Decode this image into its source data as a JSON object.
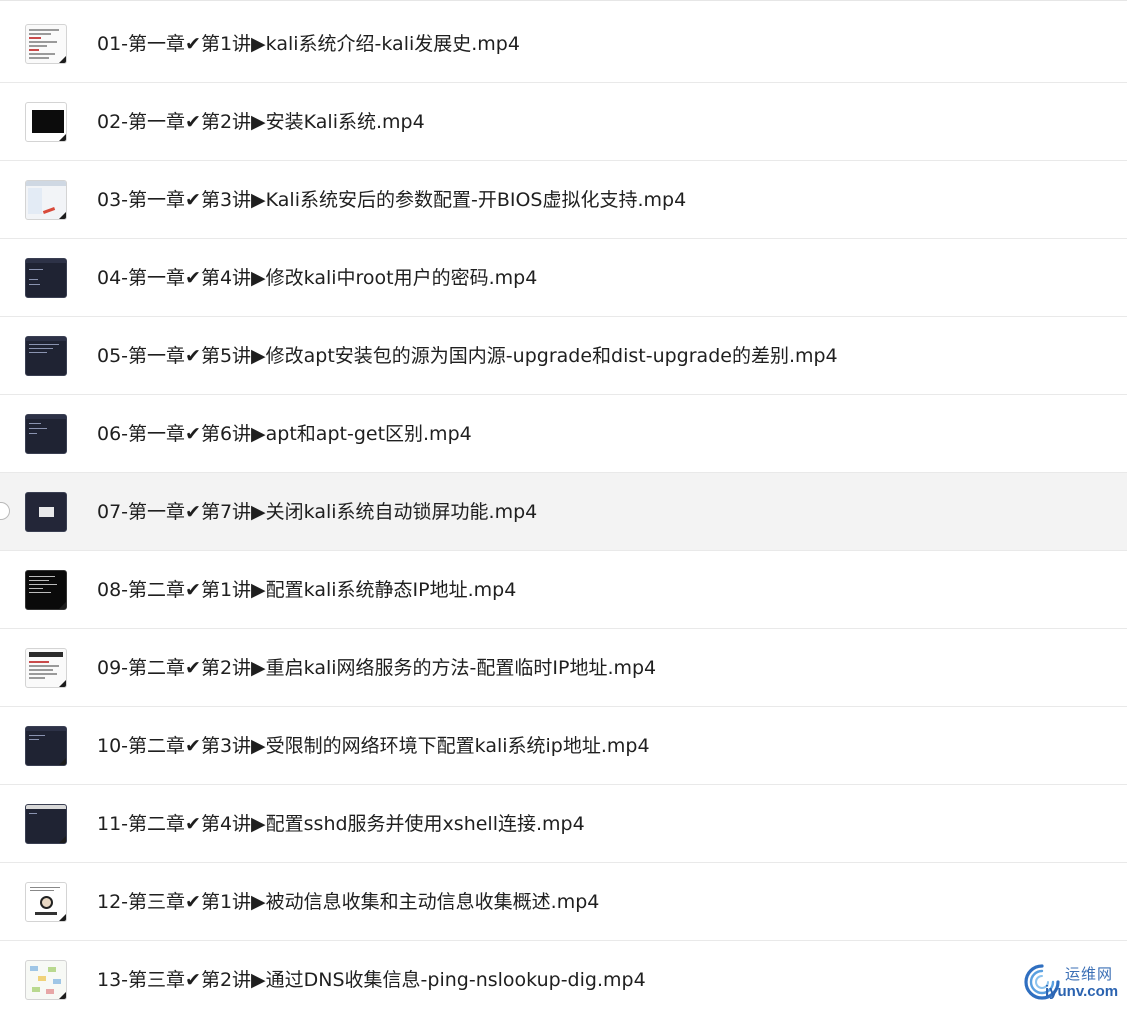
{
  "files": [
    {
      "name": "01-第一章✔第1讲▶kali系统介绍-kali发展史.mp4",
      "thumbnail": "document-thumbnail"
    },
    {
      "name": "02-第一章✔第2讲▶安装Kali系统.mp4",
      "thumbnail": "black-screen-thumbnail"
    },
    {
      "name": "03-第一章✔第3讲▶Kali系统安后的参数配置-开BIOS虚拟化支持.mp4",
      "thumbnail": "window-settings-thumbnail"
    },
    {
      "name": "04-第一章✔第4讲▶修改kali中root用户的密码.mp4",
      "thumbnail": "terminal-thumbnail"
    },
    {
      "name": "05-第一章✔第5讲▶修改apt安装包的源为国内源-upgrade和dist-upgrade的差别.mp4",
      "thumbnail": "terminal-thumbnail"
    },
    {
      "name": "06-第一章✔第6讲▶apt和apt-get区别.mp4",
      "thumbnail": "terminal-thumbnail"
    },
    {
      "name": "07-第一章✔第7讲▶关闭kali系统自动锁屏功能.mp4",
      "thumbnail": "dialog-thumbnail"
    },
    {
      "name": "08-第二章✔第1讲▶配置kali系统静态IP地址.mp4",
      "thumbnail": "command-line-thumbnail"
    },
    {
      "name": "09-第二章✔第2讲▶重启kali网络服务的方法-配置临时IP地址.mp4",
      "thumbnail": "document-thumbnail"
    },
    {
      "name": "10-第二章✔第3讲▶受限制的网络环境下配置kali系统ip地址.mp4",
      "thumbnail": "terminal-thumbnail"
    },
    {
      "name": "11-第二章✔第4讲▶配置sshd服务并使用xshell连接.mp4",
      "thumbnail": "terminal-thumbnail"
    },
    {
      "name": "12-第三章✔第1讲▶被动信息收集和主动信息收集概述.mp4",
      "thumbnail": "cartoon-face-thumbnail"
    },
    {
      "name": "13-第三章✔第2讲▶通过DNS收集信息-ping-nslookup-dig.mp4",
      "thumbnail": "mind-map-thumbnail"
    }
  ],
  "selected_index": 6,
  "watermark": {
    "name": "运维网",
    "domain": "iyunv.com",
    "icon": "swirl-logo-icon"
  },
  "colors": {
    "text": "#1f1f1f",
    "separator": "#e9e9e9",
    "selected_row": "#f3f3f3",
    "watermark_blue": "#2b63b0"
  }
}
